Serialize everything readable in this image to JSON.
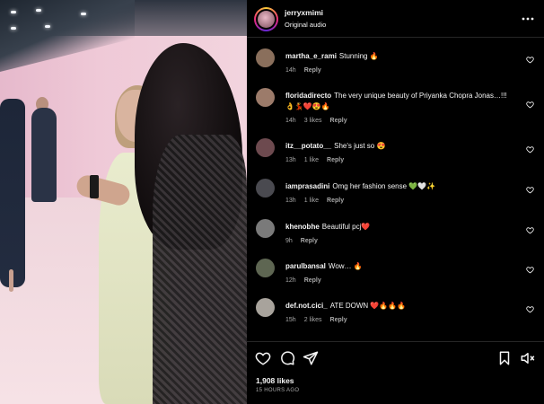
{
  "post": {
    "username": "jerryxmimi",
    "audio": "Original audio",
    "likes": "1,908 likes",
    "time_ago": "15 HOURS AGO"
  },
  "comments": [
    {
      "user": "martha_e_rami",
      "text": "Stunning 🔥",
      "time": "14h",
      "likes": "",
      "reply": "Reply",
      "avatar_color": "#8a6f5c"
    },
    {
      "user": "floridadirecto",
      "text": "The very unique beauty of Priyanka Chopra Jonas…!!!👌💃❤️😍🔥",
      "time": "14h",
      "likes": "3 likes",
      "reply": "Reply",
      "avatar_color": "#9c7b6a"
    },
    {
      "user": "itz__potato__",
      "text": "She's just so 😍",
      "time": "13h",
      "likes": "1 like",
      "reply": "Reply",
      "avatar_color": "#6d4a4f"
    },
    {
      "user": "iamprasadini",
      "text": "Omg her fashion sense 💚🤍✨",
      "time": "13h",
      "likes": "1 like",
      "reply": "Reply",
      "avatar_color": "#4a4a50"
    },
    {
      "user": "khenobhe",
      "text": "Beautiful pcj❤️",
      "time": "9h",
      "likes": "",
      "reply": "Reply",
      "avatar_color": "#7a7a7a"
    },
    {
      "user": "parulbansal",
      "text": "Wow… 🔥",
      "time": "12h",
      "likes": "",
      "reply": "Reply",
      "avatar_color": "#5e6652"
    },
    {
      "user": "def.not.cici_",
      "text": "ATE DOWN ❤️🔥🔥🔥",
      "time": "15h",
      "likes": "2 likes",
      "reply": "Reply",
      "avatar_color": "#a8a39c"
    }
  ]
}
